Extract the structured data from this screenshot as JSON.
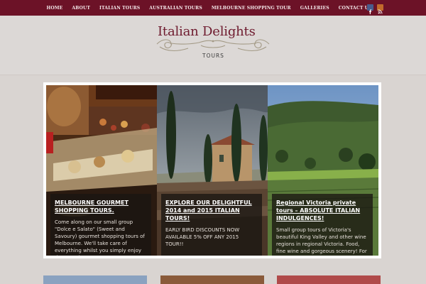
{
  "nav": {
    "items": [
      "HOME",
      "ABOUT",
      "ITALIAN TOURS",
      "AUSTRALIAN TOURS",
      "MELBOURNE SHOPPING TOUR",
      "GALLERIES",
      "CONTACT US"
    ],
    "social": [
      "facebook-icon",
      "rss-icon"
    ]
  },
  "logo": {
    "title": "Italian Delights",
    "subtitle": "TOURS"
  },
  "slides": [
    {
      "heading": "MELBOURNE GOURMET SHOPPING TOURS.",
      "body": "Come along on our small group \"Dolce e Salato\" (Sweet and Savoury) gourmet shopping tours of Melbourne. We'll take care of everything whilst you simply enjoy the experience!"
    },
    {
      "heading": "EXPLORE OUR DELIGHTFUL 2014 and 2015 ITALIAN TOURS!",
      "body": "EARLY BIRD DISCOUNTS NOW AVAILABLE 5% OFF ANY 2015 TOUR!!"
    },
    {
      "heading": "Regional Victoria private tours – ABSOLUTE ITALIAN INDULGENCES!",
      "body": "Small group tours of Victoria's beautiful King Valley and other wine regions in regional Victoria. Food, fine wine and gorgeous scenery! For the consummate foodies amongst us"
    }
  ],
  "colors": {
    "nav_bg": "#6c1227",
    "logo_text": "#6e1a2e",
    "page_bg": "#d9d4d1"
  }
}
